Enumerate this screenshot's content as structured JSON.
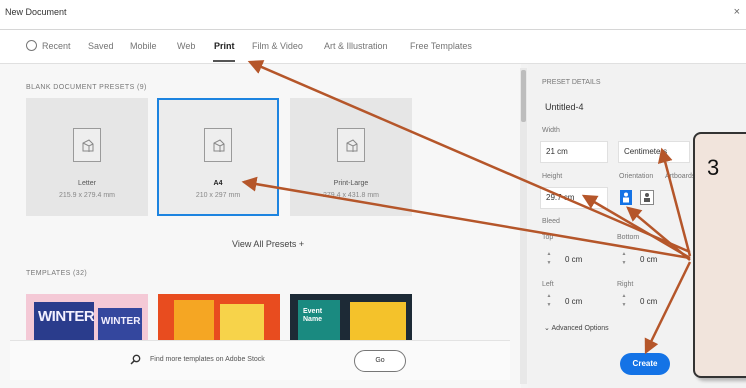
{
  "window": {
    "title": "New Document",
    "close": "×"
  },
  "tabs": [
    {
      "label": "Recent"
    },
    {
      "label": "Saved"
    },
    {
      "label": "Mobile"
    },
    {
      "label": "Web"
    },
    {
      "label": "Print",
      "active": true
    },
    {
      "label": "Film & Video"
    },
    {
      "label": "Art & Illustration"
    },
    {
      "label": "Free Templates"
    }
  ],
  "blank_presets": {
    "heading": "BLANK DOCUMENT PRESETS (9)",
    "items": [
      {
        "name": "Letter",
        "size": "215.9 x 279.4 mm"
      },
      {
        "name": "A4",
        "size": "210 x 297 mm",
        "selected": true
      },
      {
        "name": "Print-Large",
        "size": "279.4 x 431.8 mm"
      }
    ],
    "view_all": "View All Presets +"
  },
  "templates": {
    "heading": "TEMPLATES (32)",
    "winter_text": "WINTER",
    "winter_text_small": "WINTER",
    "event_text": "Event Name"
  },
  "search": {
    "placeholder": "Find more templates on Adobe Stock",
    "go": "Go"
  },
  "preset_details": {
    "heading": "PRESET DETAILS",
    "name": "Untitled-4",
    "width_label": "Width",
    "width_value": "21 cm",
    "units_value": "Centimeters",
    "height_label": "Height",
    "height_value": "29.7 cm",
    "orientation_label": "Orientation",
    "artboards_label": "Artboards",
    "bleed_label": "Bleed",
    "top_label": "Top",
    "bottom_label": "Bottom",
    "left_label": "Left",
    "right_label": "Right",
    "top_value": "0 cm",
    "bottom_value": "0 cm",
    "left_value": "0 cm",
    "right_value": "0 cm",
    "advanced": "Advanced Options",
    "create": "Create"
  },
  "callout": {
    "number": "3"
  },
  "colors": {
    "accent": "#1473e6",
    "arrow": "#b5562a",
    "selection": "#1d84e0"
  }
}
